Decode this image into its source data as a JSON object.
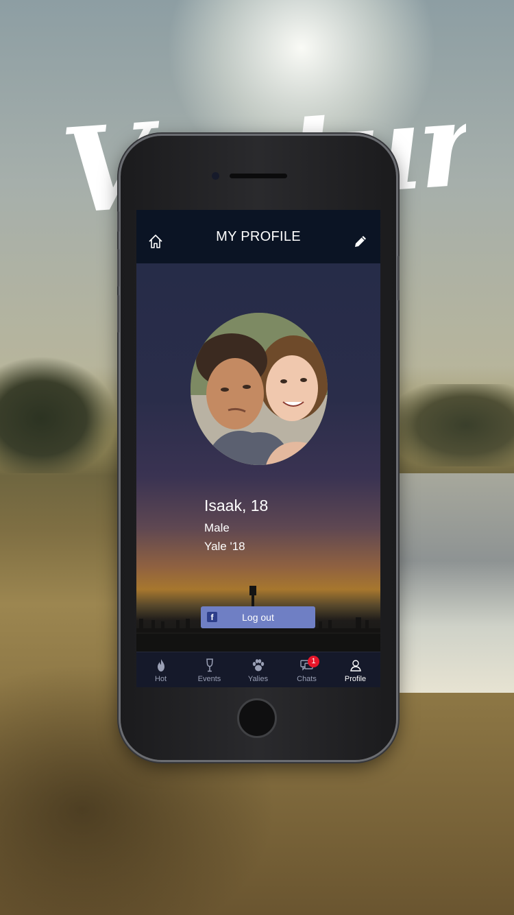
{
  "app": {
    "logo_text": "Venture"
  },
  "header": {
    "title": "MY PROFILE",
    "left_icon": "home-icon",
    "right_icon": "pencil-icon"
  },
  "profile": {
    "name": "Isaak,  18",
    "gender": "Male",
    "school": "Yale '18"
  },
  "logout": {
    "label": "Log out",
    "icon": "facebook-icon"
  },
  "tabs": [
    {
      "label": "Hot",
      "icon": "flame-icon",
      "active": false
    },
    {
      "label": "Events",
      "icon": "wine-glass-icon",
      "active": false
    },
    {
      "label": "Yalies",
      "icon": "paw-icon",
      "active": false
    },
    {
      "label": "Chats",
      "icon": "chat-bubbles-icon",
      "active": false,
      "badge": "1"
    },
    {
      "label": "Profile",
      "icon": "person-icon",
      "active": true
    }
  ],
  "colors": {
    "nav_bar": "#0b1424",
    "logout_button": "#6f7fc4",
    "badge": "#e8162a",
    "tab_active": "#ffffff",
    "tab_inactive": "#9aa0b5"
  }
}
